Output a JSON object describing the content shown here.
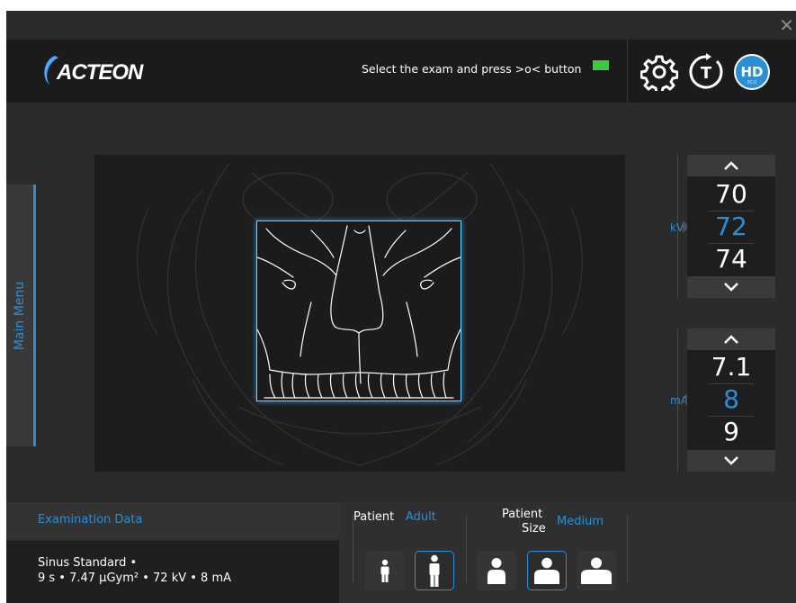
{
  "window": {
    "close_glyph": "✕"
  },
  "header": {
    "logo_text": "ACTEON",
    "instruction": "Select the exam and press >o< button",
    "status_color": "#3ec93e",
    "icons": [
      "gear-icon",
      "timer-t-icon",
      "hd-icon"
    ],
    "t_label": "T",
    "hd_label": "HD",
    "hd_sub": "ECO"
  },
  "sidebar": {
    "main_menu_label": "Main Menu"
  },
  "kv": {
    "unit": "kV",
    "prev": "70",
    "current": "72",
    "next": "74"
  },
  "ma": {
    "unit": "mA",
    "prev": "7.1",
    "current": "8",
    "next": "9"
  },
  "exam": {
    "title": "Examination Data",
    "line1": "Sinus Standard •",
    "line2": "9 s • 7.47 μGym² • 72 kV • 8 mA"
  },
  "patient": {
    "type_label": "Patient",
    "type_value": "Adult",
    "size_label_1": "Patient",
    "size_label_2": "Size",
    "size_value": "Medium",
    "selected_type": "adult",
    "selected_size": "medium"
  },
  "colors": {
    "accent": "#2b8fd6",
    "selection_border": "#6fd3ff",
    "background": "#2b2b2b"
  }
}
